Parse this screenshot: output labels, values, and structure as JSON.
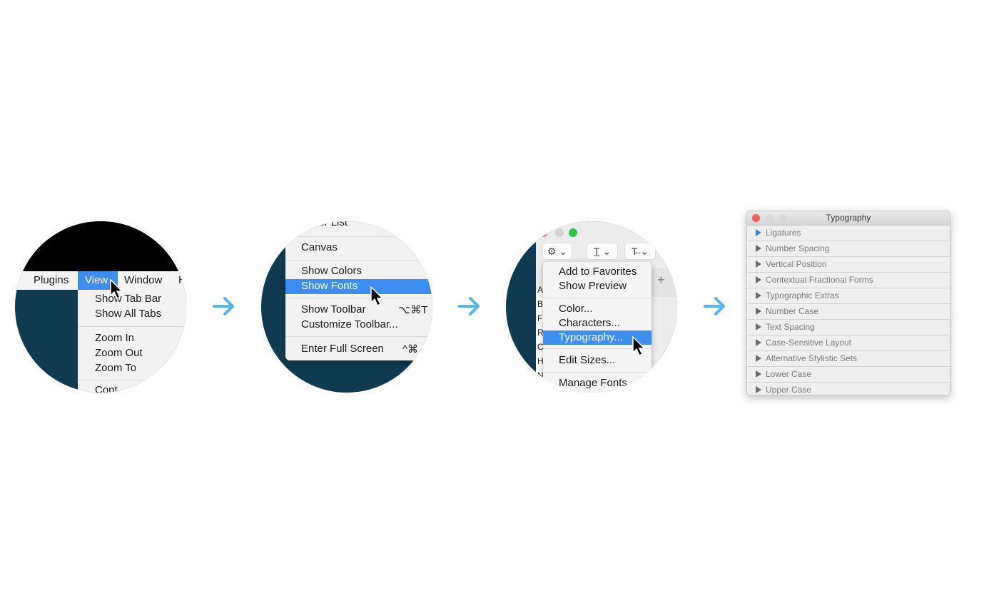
{
  "step1": {
    "menubar": [
      "Plugins",
      "View",
      "Window",
      "H"
    ],
    "active_menu": "View",
    "items": [
      "Show Tab Bar",
      "Show All Tabs",
      "Zoom In",
      "Zoom Out",
      "Zoom To",
      "Cont"
    ]
  },
  "step2": {
    "items": [
      {
        "label": "Layer List",
        "shortcut": ""
      },
      {
        "label": "Canvas",
        "shortcut": ""
      },
      {
        "label": "Show Colors",
        "shortcut": ""
      },
      {
        "label": "Show Fonts",
        "shortcut": "",
        "highlighted": true
      },
      {
        "label": "Show Toolbar",
        "shortcut": "⌥⌘T"
      },
      {
        "label": "Customize Toolbar...",
        "shortcut": ""
      },
      {
        "label": "Enter Full Screen",
        "shortcut": "^⌘"
      }
    ]
  },
  "step3": {
    "toolbar": {
      "gear": "⚙",
      "chev": "⌄",
      "text_color": "T",
      "strike": "T̶",
      "plus": "+"
    },
    "list_letters": [
      "A",
      "B",
      "F",
      "R",
      "C",
      "H",
      "N"
    ],
    "items": [
      "Add to Favorites",
      "Show Preview",
      "Color...",
      "Characters...",
      "Typography...",
      "Edit Sizes...",
      "Manage Fonts"
    ],
    "highlighted": "Typography..."
  },
  "typography_panel": {
    "title": "Typography",
    "rows": [
      "Ligatures",
      "Number Spacing",
      "Vertical Position",
      "Contextual Fractional Forms",
      "Typographic Extras",
      "Number Case",
      "Text Spacing",
      "Case-Sensitive Layout",
      "Alternative Stylistic Sets",
      "Lower Case",
      "Upper Case"
    ],
    "active_row": "Ligatures"
  },
  "colors": {
    "arrow": "#4fb8ec",
    "highlight": "#3d8ef0",
    "background_dark": "#0f3a50"
  }
}
